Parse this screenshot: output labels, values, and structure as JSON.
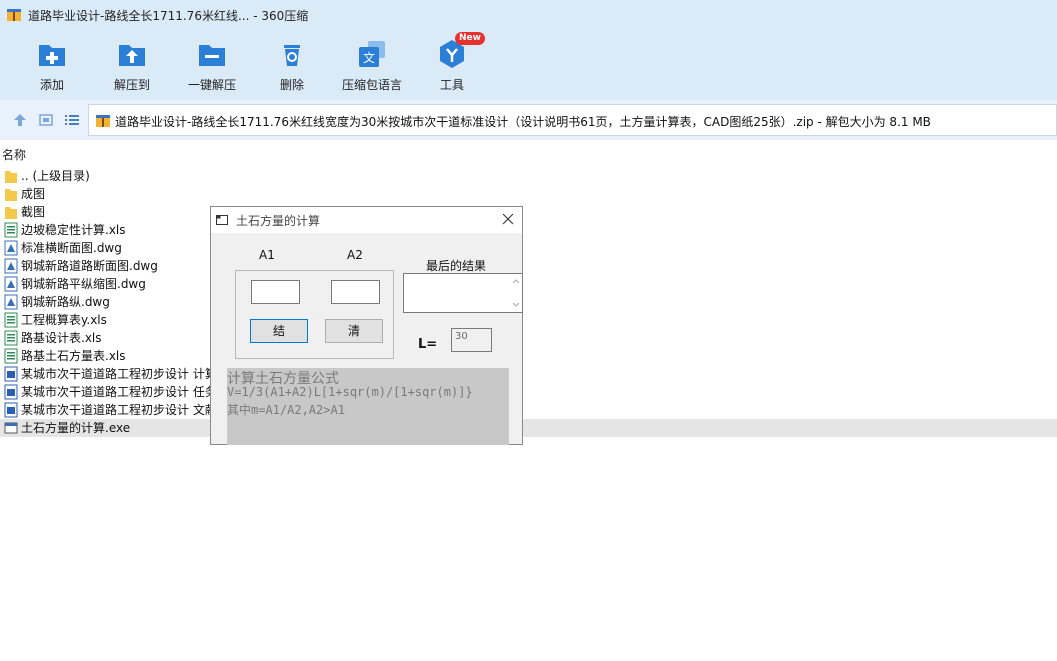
{
  "window": {
    "title": "道路毕业设计-路线全长1711.76米红线... - 360压缩"
  },
  "toolbar": {
    "items": [
      {
        "label": "添加",
        "icon": "add-archive-icon"
      },
      {
        "label": "解压到",
        "icon": "extract-to-icon"
      },
      {
        "label": "一键解压",
        "icon": "one-click-extract-icon"
      },
      {
        "label": "删除",
        "icon": "delete-icon"
      },
      {
        "label": "压缩包语言",
        "icon": "archive-language-icon"
      },
      {
        "label": "工具",
        "icon": "tools-icon",
        "badge": "New"
      }
    ],
    "accent": "#2b7fd6"
  },
  "address": {
    "path": "道路毕业设计-路线全长1711.76米红线宽度为30米按城市次干道标准设计（设计说明书61页，土方量计算表，CAD图纸25张）.zip - 解包大小为 8.1 MB"
  },
  "filelist": {
    "header_name": "名称",
    "rows": [
      {
        "name": ".. (上级目录)",
        "icon": "folder-icon"
      },
      {
        "name": "成图",
        "icon": "folder-icon"
      },
      {
        "name": "截图",
        "icon": "folder-icon"
      },
      {
        "name": "边坡稳定性计算.xls",
        "icon": "excel-file-icon"
      },
      {
        "name": "标准横断面图.dwg",
        "icon": "dwg-file-icon"
      },
      {
        "name": "钢城新路道路断面图.dwg",
        "icon": "dwg-file-icon"
      },
      {
        "name": "钢城新路平纵缩图.dwg",
        "icon": "dwg-file-icon"
      },
      {
        "name": "钢城新路纵.dwg",
        "icon": "dwg-file-icon"
      },
      {
        "name": "工程概算表y.xls",
        "icon": "excel-file-icon"
      },
      {
        "name": "路基设计表.xls",
        "icon": "excel-file-icon"
      },
      {
        "name": "路基土石方量表.xls",
        "icon": "excel-file-icon"
      },
      {
        "name": "某城市次干道道路工程初步设计 计算",
        "icon": "word-file-icon"
      },
      {
        "name": "某城市次干道道路工程初步设计 任务",
        "icon": "word-file-icon"
      },
      {
        "name": "某城市次干道道路工程初步设计 文献",
        "icon": "word-file-icon"
      },
      {
        "name": "土石方量的计算.exe",
        "icon": "exe-file-icon",
        "selected": true
      }
    ]
  },
  "dialog": {
    "title": "土石方量的计算",
    "label_a1": "A1",
    "label_a2": "A2",
    "a1_value": "",
    "a2_value": "",
    "button_compute": "结",
    "button_clear": "清",
    "result_label": "最后的结果",
    "result_value": "",
    "l_label": "L=",
    "l_value": "30",
    "formula_line1": "计算土石方量公式",
    "formula_line2": "V=1/3(A1+A2)L[1+sqr(m)/[1+sqr(m)]}",
    "formula_line3": "其中m=A1/A2,A2>A1"
  }
}
